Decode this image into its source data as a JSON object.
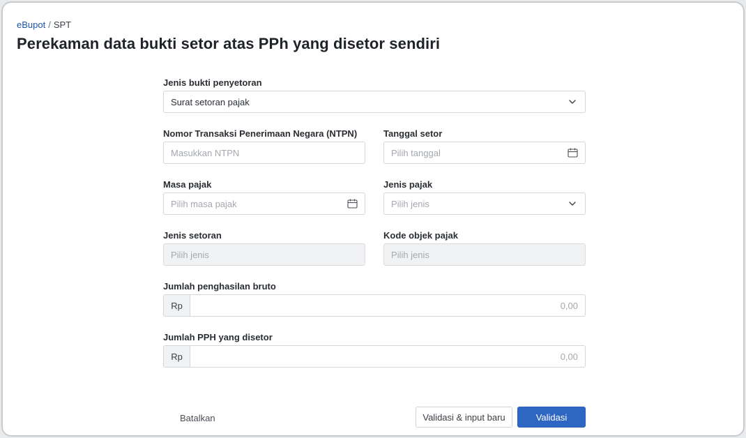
{
  "breadcrumb": {
    "root": "eBupot",
    "separator": "/",
    "current": "SPT"
  },
  "page": {
    "title": "Perekaman data bukti setor atas PPh yang disetor sendiri"
  },
  "form": {
    "jenis_bukti": {
      "label": "Jenis bukti penyetoran",
      "value": "Surat setoran pajak"
    },
    "ntpn": {
      "label": "Nomor Transaksi Penerimaan Negara (NTPN)",
      "placeholder": "Masukkan NTPN"
    },
    "tanggal_setor": {
      "label": "Tanggal setor",
      "placeholder": "Pilih tanggal"
    },
    "masa_pajak": {
      "label": "Masa pajak",
      "placeholder": "Pilih masa pajak"
    },
    "jenis_pajak": {
      "label": "Jenis pajak",
      "placeholder": "Pilih jenis"
    },
    "jenis_setoran": {
      "label": "Jenis setoran",
      "placeholder": "Pilih jenis"
    },
    "kode_objek": {
      "label": "Kode objek pajak",
      "placeholder": "Pilih jenis"
    },
    "penghasilan_bruto": {
      "label": "Jumlah penghasilan bruto",
      "prefix": "Rp",
      "value": "0,00"
    },
    "pph_disetor": {
      "label": "Jumlah PPH yang disetor",
      "prefix": "Rp",
      "value": "0,00"
    }
  },
  "actions": {
    "cancel": "Batalkan",
    "validate_new": "Validasi & input baru",
    "validate": "Validasi"
  },
  "colors": {
    "primary": "#2d66c3",
    "link": "#1b54a8",
    "disabled_bg": "#f1f2f4"
  },
  "icons": {
    "dropdown": "chevron-down-icon",
    "date": "calendar-icon"
  }
}
